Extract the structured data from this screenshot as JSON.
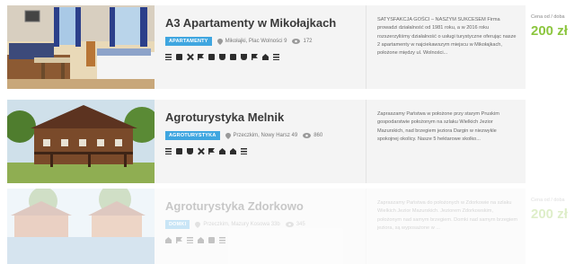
{
  "listings": [
    {
      "title": "A3 Apartamenty w Mikołajkach",
      "category": "APARTAMENTY",
      "location": "Mikołajki, Plac Wolności 9",
      "views": "172",
      "amenity_icons": [
        "bed-icon",
        "lock-icon",
        "no-smoking-icon",
        "cutlery-icon",
        "trash-icon",
        "toilet-icon",
        "monitor-icon",
        "wine-icon",
        "flag-icon",
        "car-icon",
        "menu-icon"
      ],
      "description": "SATYSFAKCJA GOŚCI – NASZYM SUKCESEM Firma prowadzi działalność od 1981 roku, a w 2016 roku rozszerzyliśmy działalność o usługi turystyczne oferując nasze 2 apartamenty w najciekawszym miejscu w Mikołajkach, położone między ul. Wolności...",
      "price_label": "Cena od / doba",
      "price": "200 zł"
    },
    {
      "title": "Agroturystyka Melnik",
      "category": "AGROTURYSTYKA",
      "location": "Przeczkim, Nowy Harsz 49",
      "views": "860",
      "amenity_icons": [
        "bed-icon",
        "lock-icon",
        "sink-icon",
        "no-smoking-icon",
        "person-icon",
        "home-icon",
        "car-icon",
        "menu-icon"
      ],
      "description": "Zapraszamy Państwa w położone przy starym Pruskim gospodarstwie położonym na szlaku Wielkich Jezior Mazurskich, nad brzegiem jeziora Dargin w niezwykle spokojnej okolicy. Nasze 5 hektarowe skolko...",
      "price_label": "",
      "price": ""
    },
    {
      "title": "Agroturystyka Zdorkowo",
      "category": "DOMKI",
      "location": "Przeczkim, Mazury Kosowa 33b",
      "views": "345",
      "amenity_icons": [
        "car-icon",
        "person-icon",
        "bed-icon",
        "home-icon",
        "monitor-icon",
        "menu-icon"
      ],
      "description": "Zapraszamy Państwa do położonych w Zdorkowie na szlaku Wielkich Jezior Mazurskich. Jeziorem Zdorkowskim, położonym nad samym brzegiem. Domki nad samym brzegiem jeziora, są wyposażone w ...",
      "price_label": "Cena od / doba",
      "price": "200 zł"
    }
  ],
  "colors": {
    "accent": "#3fa6e0",
    "price": "#8cc63f"
  }
}
